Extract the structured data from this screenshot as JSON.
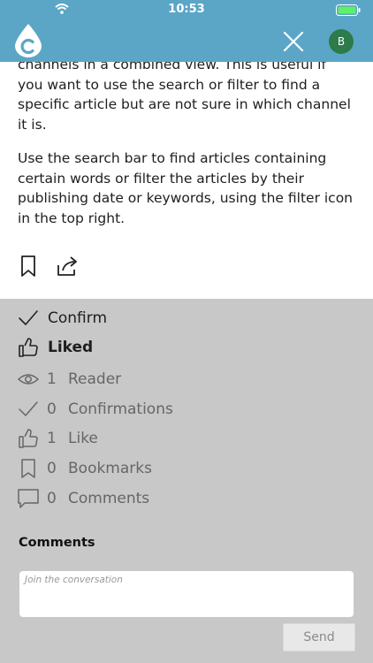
{
  "status_bar": {
    "time": "10:53"
  },
  "header": {
    "avatar_initial": "B"
  },
  "article": {
    "paragraph_1": "channels in a combined view. This is useful if you want to use the search or filter to find a specific article but are not sure in which channel it is.",
    "paragraph_2": "Use the search bar to find articles containing certain words or filter the articles by their publishing date or keywords, using the filter icon in the top right."
  },
  "actions": {
    "confirm_label": "Confirm",
    "liked_label": "Liked"
  },
  "stats": {
    "readers": {
      "count": "1",
      "label": "Reader"
    },
    "confirmations": {
      "count": "0",
      "label": "Confirmations"
    },
    "likes": {
      "count": "1",
      "label": "Like"
    },
    "bookmarks": {
      "count": "0",
      "label": "Bookmarks"
    },
    "comments": {
      "count": "0",
      "label": "Comments"
    }
  },
  "comments": {
    "title": "Comments",
    "placeholder": "Join the conversation",
    "send_label": "Send"
  }
}
